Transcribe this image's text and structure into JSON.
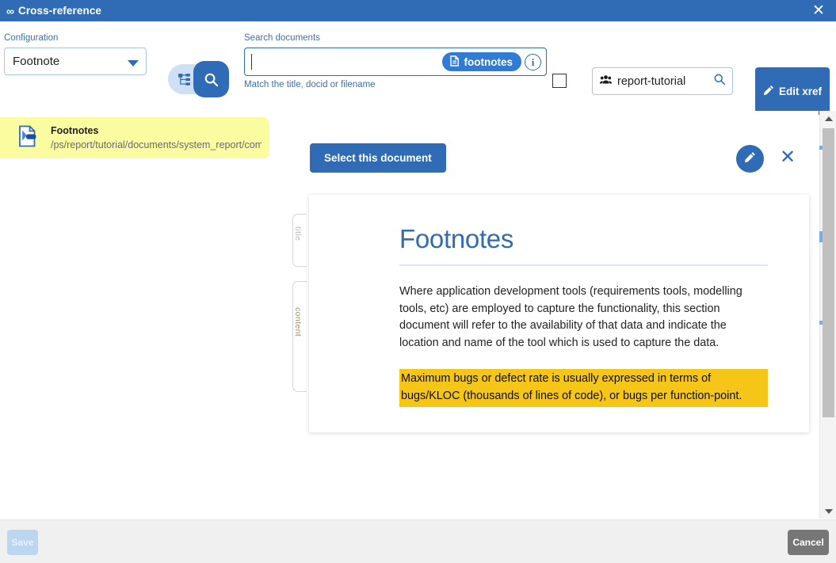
{
  "window": {
    "icon": "infinity-link-icon",
    "title": "Cross-reference",
    "close_label": "✕"
  },
  "toolbar": {
    "configuration": {
      "label": "Configuration",
      "value": "Footnote",
      "caret_icon": "chevron-down-icon"
    },
    "mode_toggle": {
      "tree_icon": "sitemap-icon",
      "search_icon": "magnifier-icon",
      "active": "search"
    },
    "search": {
      "label": "Search documents",
      "value": "",
      "placeholder": "",
      "hint": "Match the title, docid or filename",
      "chip": {
        "icon": "document-icon",
        "text": "footnotes"
      },
      "info_icon": "info-icon",
      "info_label": "i"
    },
    "checkbox": {
      "checked": false
    },
    "group": {
      "icon": "group-users-icon",
      "value": "report-tutorial",
      "search_icon": "magnifier-icon"
    },
    "edit_xref": {
      "icon": "pencil-icon",
      "label": "Edit xref"
    }
  },
  "results": [
    {
      "icon": "document-link-icon",
      "title": "Footnotes",
      "path": "/ps/report/tutorial/documents/system_report/comp"
    }
  ],
  "preview": {
    "select_button": "Select this document",
    "edit_icon": "pencil-icon",
    "close_icon": "close-icon",
    "close_label": "✕",
    "fields": {
      "title_label": "title",
      "content_label": "content"
    },
    "document": {
      "title": "Footnotes",
      "paragraph": "Where application development tools (requirements tools, modelling tools, etc) are employed to capture the functionality, this section document will refer to the availability of that data and indicate the location and name of the tool which is used to capture the data.",
      "highlighted": "Maximum bugs or defect rate is usually expressed in terms of bugs/KLOC (thousands of lines of code), or bugs per function-point."
    }
  },
  "scrollbar": {
    "up_icon": "caret-up-icon",
    "down_icon": "caret-down-icon"
  },
  "footer": {
    "save_label": "Save",
    "cancel_label": "Cancel"
  },
  "colors": {
    "brand_blue": "#2f6cb5",
    "chip_blue": "#2f7bd6",
    "result_highlight": "#fbfba0",
    "text_highlight": "#f5c518",
    "footer_bg": "#f0f0f0",
    "cancel_gray": "#767676",
    "save_disabled": "#bcd5f2"
  }
}
